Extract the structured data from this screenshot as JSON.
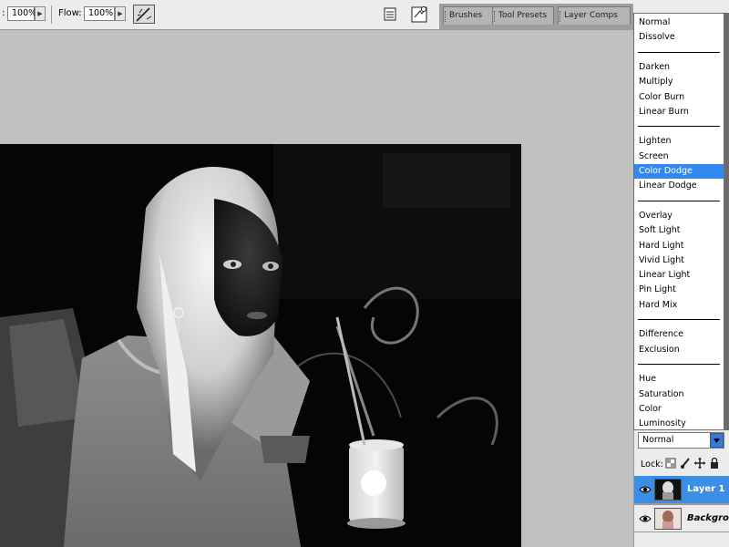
{
  "toolbar": {
    "opacity_value": "100%",
    "flow_label": "Flow:",
    "flow_value": "100%",
    "opacity_label_cut": ":"
  },
  "palette_tabs": [
    "Brushes",
    "Tool Presets",
    "Layer Comps"
  ],
  "blend_menu": {
    "groups": [
      [
        "Normal",
        "Dissolve"
      ],
      [
        "Darken",
        "Multiply",
        "Color Burn",
        "Linear Burn"
      ],
      [
        "Lighten",
        "Screen",
        "Color Dodge",
        "Linear Dodge"
      ],
      [
        "Overlay",
        "Soft Light",
        "Hard Light",
        "Vivid Light",
        "Linear Light",
        "Pin Light",
        "Hard Mix"
      ],
      [
        "Difference",
        "Exclusion"
      ],
      [
        "Hue",
        "Saturation",
        "Color",
        "Luminosity"
      ]
    ],
    "selected": "Color Dodge",
    "selection_color": "#3388ee"
  },
  "layers_panel": {
    "blend_mode": "Normal",
    "lock_label": "Lock:",
    "layers": [
      {
        "name": "Layer 1",
        "selected": true
      },
      {
        "name": "Backgrou",
        "selected": false
      }
    ],
    "selection_color": "#3a8ee6"
  },
  "icons": {
    "airbrush": "airbrush-icon",
    "palette": "palette-icon",
    "file_browser": "file-browser-icon",
    "lock_transparent": "lock-transparent-icon",
    "lock_paint": "lock-paint-icon",
    "lock_move": "lock-move-icon",
    "lock_all": "lock-all-icon",
    "eye": "eye-icon"
  }
}
